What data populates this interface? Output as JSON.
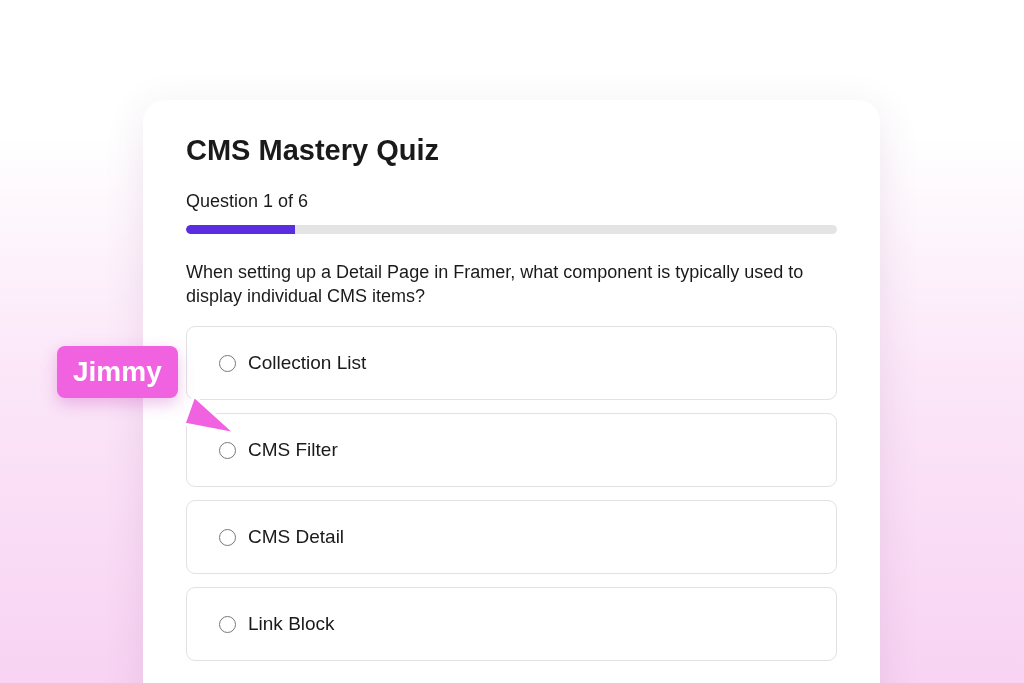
{
  "quiz": {
    "title": "CMS Mastery Quiz",
    "progress_label": "Question 1 of 6",
    "progress": {
      "level": 0.167
    },
    "question": "When setting up a Detail Page in Framer, what component is typically used to display individual CMS items?",
    "options": [
      {
        "label": "Collection List",
        "selected": false
      },
      {
        "label": "CMS Filter",
        "selected": false
      },
      {
        "label": "CMS Detail",
        "selected": false
      },
      {
        "label": "Link Block",
        "selected": false
      }
    ]
  },
  "cursor": {
    "name": "Jimmy"
  }
}
